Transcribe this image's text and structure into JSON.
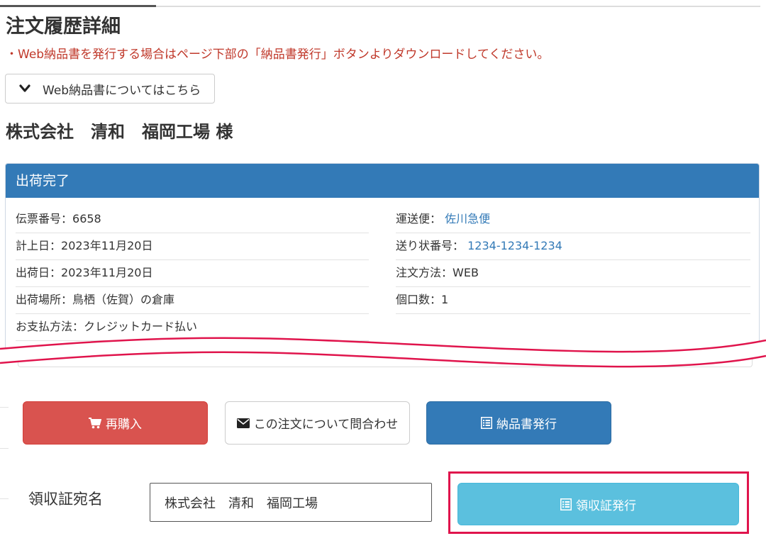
{
  "page": {
    "title": "注文履歴詳細",
    "notice": "・Web納品書を発行する場合はページ下部の「納品書発行」ボタンよりダウンロードしてください。",
    "web_invoice_toggle": "Web納品書についてはこちら",
    "customer_name": "株式会社　清和　福岡工場  様"
  },
  "order": {
    "status": "出荷完了",
    "left": [
      {
        "label": "伝票番号：",
        "value": "6658"
      },
      {
        "label": "計上日：",
        "value": "2023年11月20日"
      },
      {
        "label": "出荷日：",
        "value": "2023年11月20日"
      },
      {
        "label": "出荷場所：",
        "value": "鳥栖（佐賀）の倉庫"
      },
      {
        "label": "お支払方法：",
        "value": "クレジットカード払い"
      }
    ],
    "right": [
      {
        "label": "運送便： ",
        "value": "佐川急便"
      },
      {
        "label": "送り状番号： ",
        "value": "1234-1234-1234"
      },
      {
        "label": "注文方法：",
        "value": "WEB"
      },
      {
        "label": "個口数：",
        "value": "1"
      }
    ]
  },
  "actions": {
    "rebuy": "再購入",
    "inquiry": "この注文について問合わせ",
    "invoice": "納品書発行"
  },
  "receipt": {
    "label": "領収証宛名",
    "name_value": "株式会社　清和　福岡工場",
    "issue_button": "領収証発行"
  },
  "icons": {
    "toggle": "chevron-down-icon",
    "rebuy": "cart-icon",
    "inquiry": "envelope-icon",
    "invoice": "list-alt-icon",
    "receipt": "list-alt-icon"
  },
  "colors": {
    "primary": "#337ab7",
    "danger": "#d9534f",
    "info": "#5bc0de",
    "notice_text": "#c0392b",
    "highlight": "#e0144c"
  }
}
